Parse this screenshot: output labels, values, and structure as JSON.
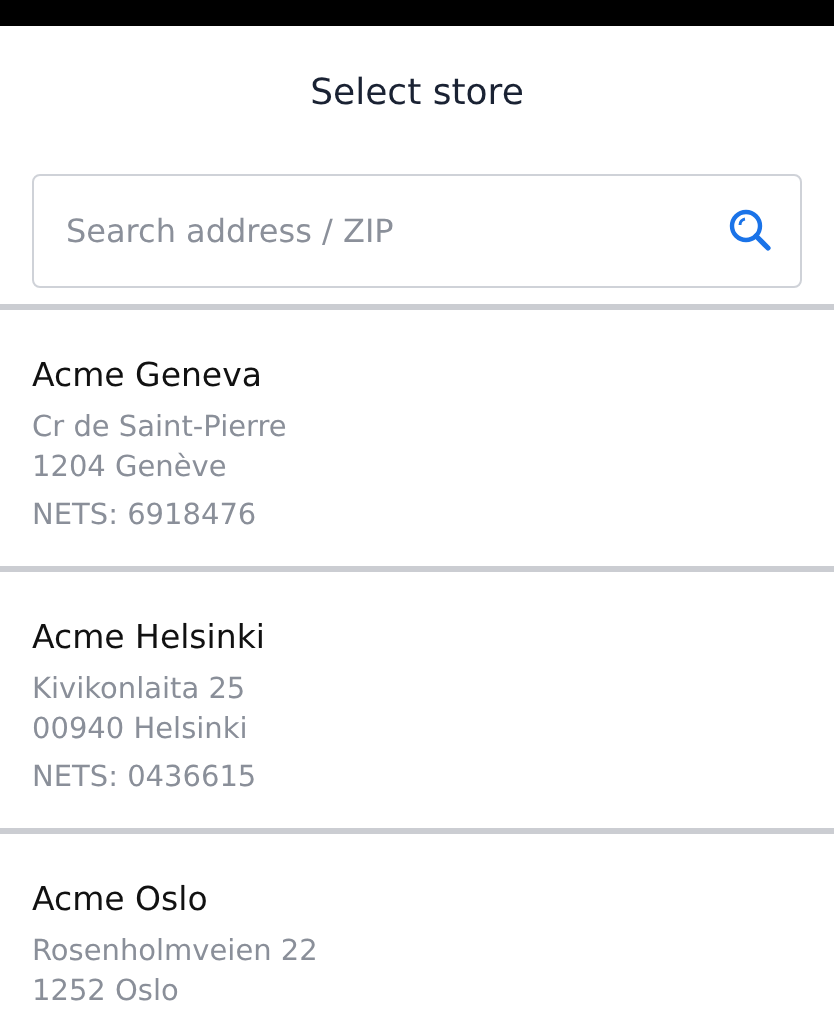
{
  "header": {
    "title": "Select store"
  },
  "search": {
    "placeholder": "Search address / ZIP"
  },
  "stores": [
    {
      "name": "Acme Geneva",
      "address": [
        "Cr de Saint-Pierre",
        "1204 Genève"
      ],
      "nets": "NETS: 6918476"
    },
    {
      "name": "Acme Helsinki",
      "address": [
        "Kivikonlaita 25",
        "00940 Helsinki"
      ],
      "nets": "NETS: 0436615"
    },
    {
      "name": "Acme Oslo",
      "address": [
        "Rosenholmveien 22",
        "1252 Oslo"
      ]
    }
  ]
}
